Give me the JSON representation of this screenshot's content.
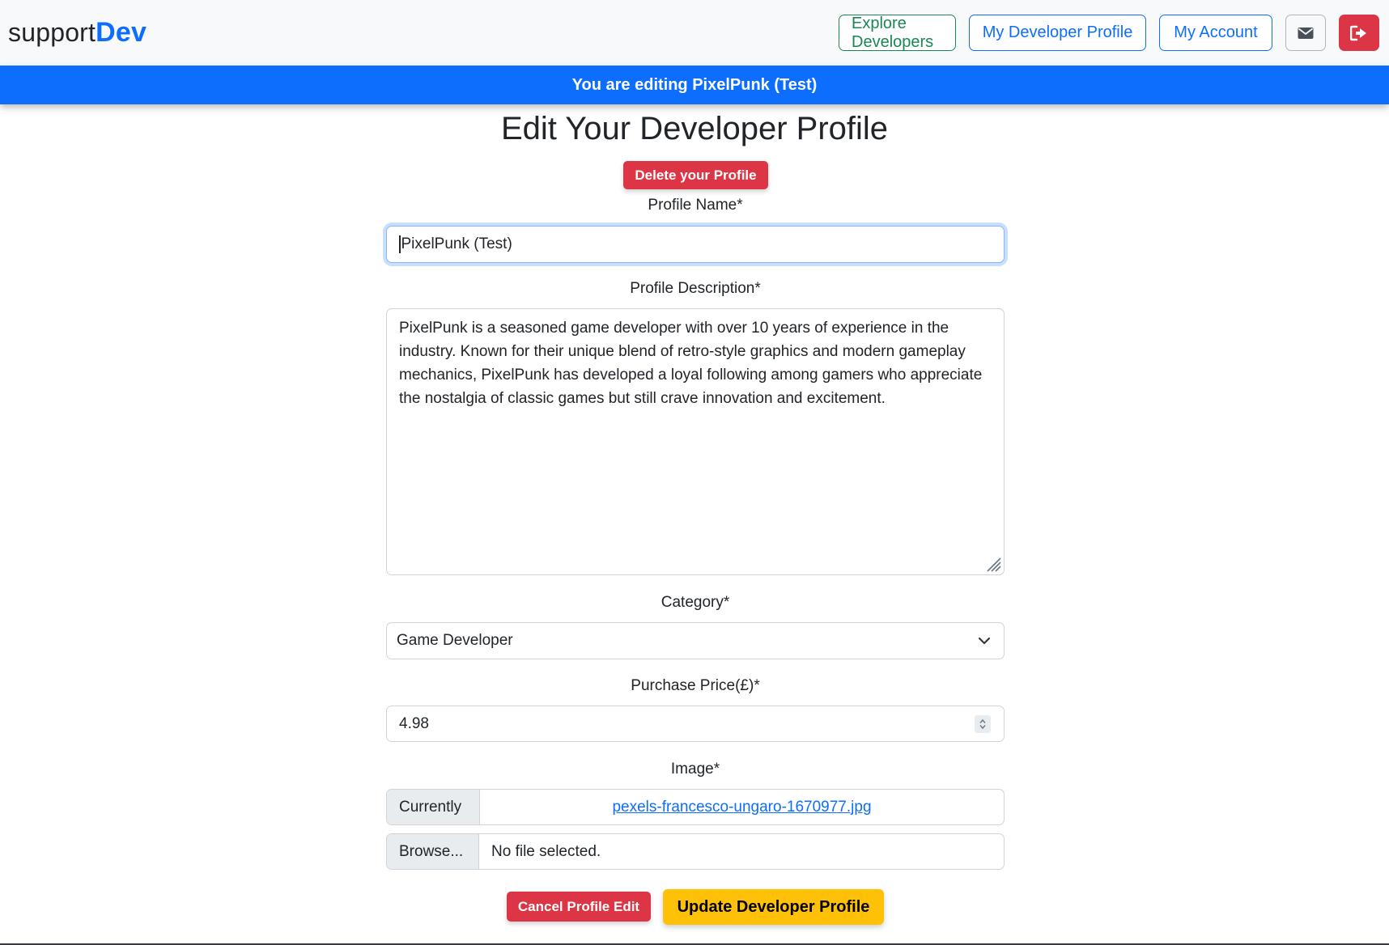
{
  "navbar": {
    "brand_prefix": "support",
    "brand_suffix": "Dev",
    "explore_label": "Explore Developers",
    "my_profile_label": "My Developer Profile",
    "my_account_label": "My Account",
    "messages_icon": "envelope-icon",
    "logout_icon": "sign-out-icon"
  },
  "banner": {
    "text": "You are editing PixelPunk (Test)"
  },
  "form": {
    "title": "Edit Your Developer Profile",
    "delete_label": "Delete your Profile",
    "name_label": "Profile Name*",
    "name_value": "PixelPunk (Test)",
    "description_label": "Profile Description*",
    "description_value": "PixelPunk is a seasoned game developer with over 10 years of experience in the industry. Known for their unique blend of retro-style graphics and modern gameplay mechanics, PixelPunk has developed a loyal following among gamers who appreciate the nostalgia of classic games but still crave innovation and excitement.",
    "category_label": "Category*",
    "category_value": "Game Developer",
    "price_label": "Purchase Price(£)*",
    "price_value": "4.98",
    "image_label": "Image*",
    "currently_label": "Currently",
    "current_file": "pexels-francesco-ungaro-1670977.jpg",
    "browse_label": "Browse...",
    "no_file_text": "No file selected.",
    "cancel_label": "Cancel Profile Edit",
    "update_label": "Update Developer Profile"
  },
  "colors": {
    "primary": "#0d6efd",
    "success": "#198754",
    "danger": "#dc3545",
    "warning": "#ffc107",
    "navbar_bg": "#f8f9fa"
  }
}
